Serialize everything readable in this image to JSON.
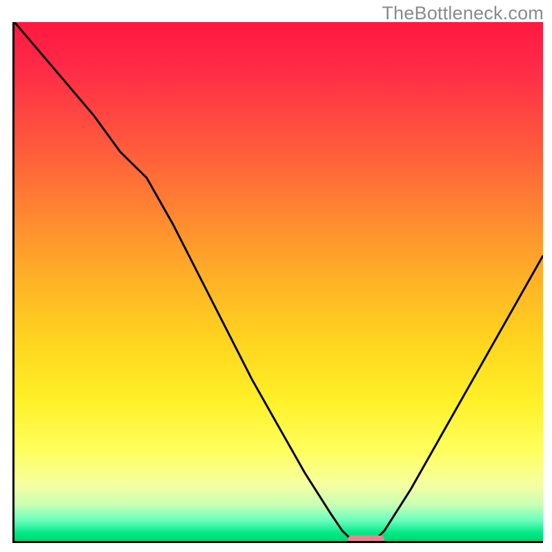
{
  "watermark": "TheBottleneck.com",
  "colors": {
    "gradient_top": "#ff1840",
    "gradient_mid": "#ffd61f",
    "gradient_bottom": "#00d874",
    "axis": "#000000",
    "curve": "#000000",
    "marker": "#e98493",
    "watermark_text": "#8a8a8a"
  },
  "chart_data": {
    "type": "line",
    "title": "",
    "xlabel": "",
    "ylabel": "",
    "xlim": [
      0,
      100
    ],
    "ylim": [
      0,
      100
    ],
    "series": [
      {
        "name": "bottleneck-curve",
        "x": [
          0,
          5,
          10,
          15,
          20,
          25,
          30,
          35,
          40,
          45,
          50,
          55,
          60,
          62,
          64,
          66,
          68,
          70,
          75,
          80,
          85,
          90,
          95,
          100
        ],
        "values": [
          100,
          94,
          88,
          82,
          75,
          70,
          61,
          51,
          41,
          31,
          22,
          13,
          5,
          2,
          0,
          0,
          0,
          2,
          10,
          19,
          28,
          37,
          46,
          55
        ]
      }
    ],
    "marker": {
      "x_start": 63,
      "x_end": 70,
      "y": 0
    },
    "annotations": []
  }
}
